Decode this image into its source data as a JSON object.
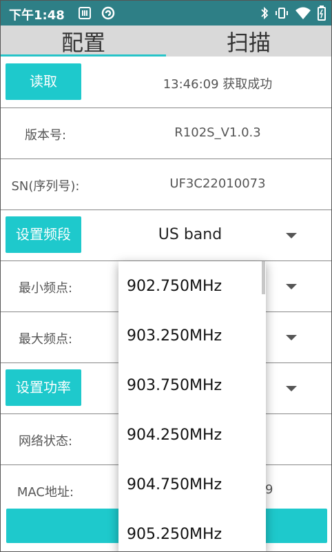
{
  "statusbar": {
    "time": "下午1:48"
  },
  "tabs": [
    {
      "label": "配置"
    },
    {
      "label": "扫描"
    }
  ],
  "rows": {
    "read": {
      "button": "读取",
      "value": "13:46:09 获取成功"
    },
    "version": {
      "label": "版本号:",
      "value": "R102S_V1.0.3"
    },
    "sn": {
      "label": "SN(序列号):",
      "value": "UF3C22010073"
    },
    "band": {
      "button": "设置频段",
      "value": "US band"
    },
    "min_freq": {
      "label": "最小频点:"
    },
    "max_freq": {
      "label": "最大频点:"
    },
    "power": {
      "button": "设置功率"
    },
    "network": {
      "label": "网络状态:"
    },
    "mac": {
      "label": "MAC地址:",
      "value_tail": "9"
    }
  },
  "dropdown": {
    "options": [
      "902.750MHz",
      "903.250MHz",
      "903.750MHz",
      "904.250MHz",
      "904.750MHz",
      "905.250MHz"
    ]
  },
  "colors": {
    "statusbar": "#2e7f86",
    "accent": "#1ec9cc",
    "tab_bg": "#d9d9d9"
  }
}
